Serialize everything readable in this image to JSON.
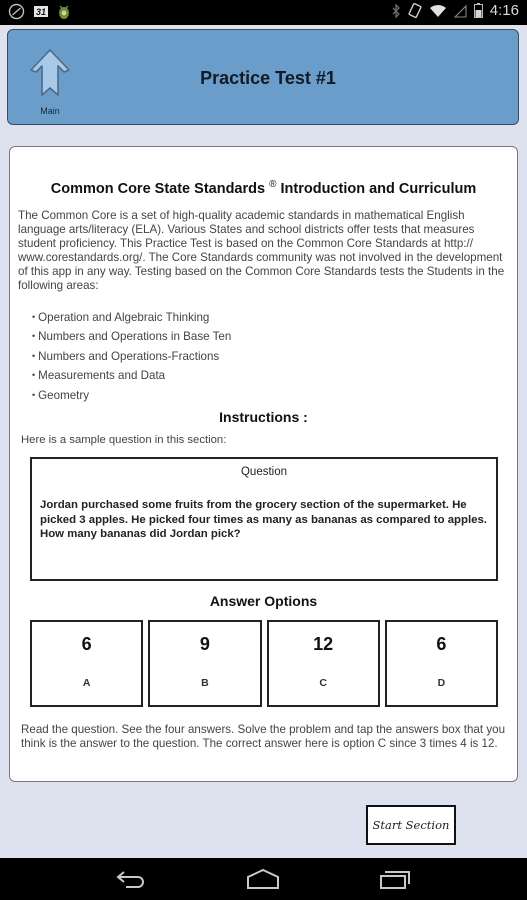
{
  "status_bar": {
    "left_icons": [
      "sync-icon",
      "calendar-icon",
      "android-bug-icon"
    ],
    "calendar_day": "31",
    "right_icons": [
      "bluetooth-icon",
      "rotate-icon",
      "wifi-icon",
      "signal-icon",
      "battery-icon"
    ],
    "time": "4:16"
  },
  "header": {
    "title": "Practice Test #1",
    "main_button_label": "Main",
    "main_button_icon": "up-arrow-icon",
    "background_color": "#6a9dc9"
  },
  "content": {
    "title": "Common Core State Standards",
    "title_mark": "®",
    "title_suffix": "Introduction and Curriculum",
    "intro": "The Common Core is a set of high-quality academic standards in mathematical English language arts/literacy (ELA). Various States and school districts offer tests that measures student proficiency. This Practice Test is based on the Common Core Standards at http:// www.corestandards.org/. The Core Standards community was not involved in the development of this app in any way. Testing based on the Common Core Standards tests the Students in the following areas:",
    "areas": [
      "Operation and Algebraic Thinking",
      "Numbers and Operations in Base Ten",
      "Numbers and Operations-Fractions",
      "Measurements and Data",
      "Geometry"
    ],
    "instructions_heading": "Instructions :",
    "sample_intro": "Here is a sample question in this section:",
    "question": {
      "label": "Question",
      "text": "Jordan purchased some fruits from the grocery section of the supermarket. He picked 3 apples. He picked four times as many as bananas as compared to apples. How many bananas did Jordan pick?"
    },
    "answer_heading": "Answer Options",
    "answers": [
      {
        "value": "6",
        "letter": "A"
      },
      {
        "value": "9",
        "letter": "B"
      },
      {
        "value": "12",
        "letter": "C"
      },
      {
        "value": "6",
        "letter": "D"
      }
    ],
    "explanation": "Read the question. See the four answers. Solve the problem and tap the answers box that you think is the answer to the question. The correct answer here is option C since 3 times 4 is 12."
  },
  "start_button": {
    "label": "Start Section"
  },
  "nav_bar": {
    "buttons": [
      "back-icon",
      "home-icon",
      "recent-apps-icon"
    ]
  }
}
